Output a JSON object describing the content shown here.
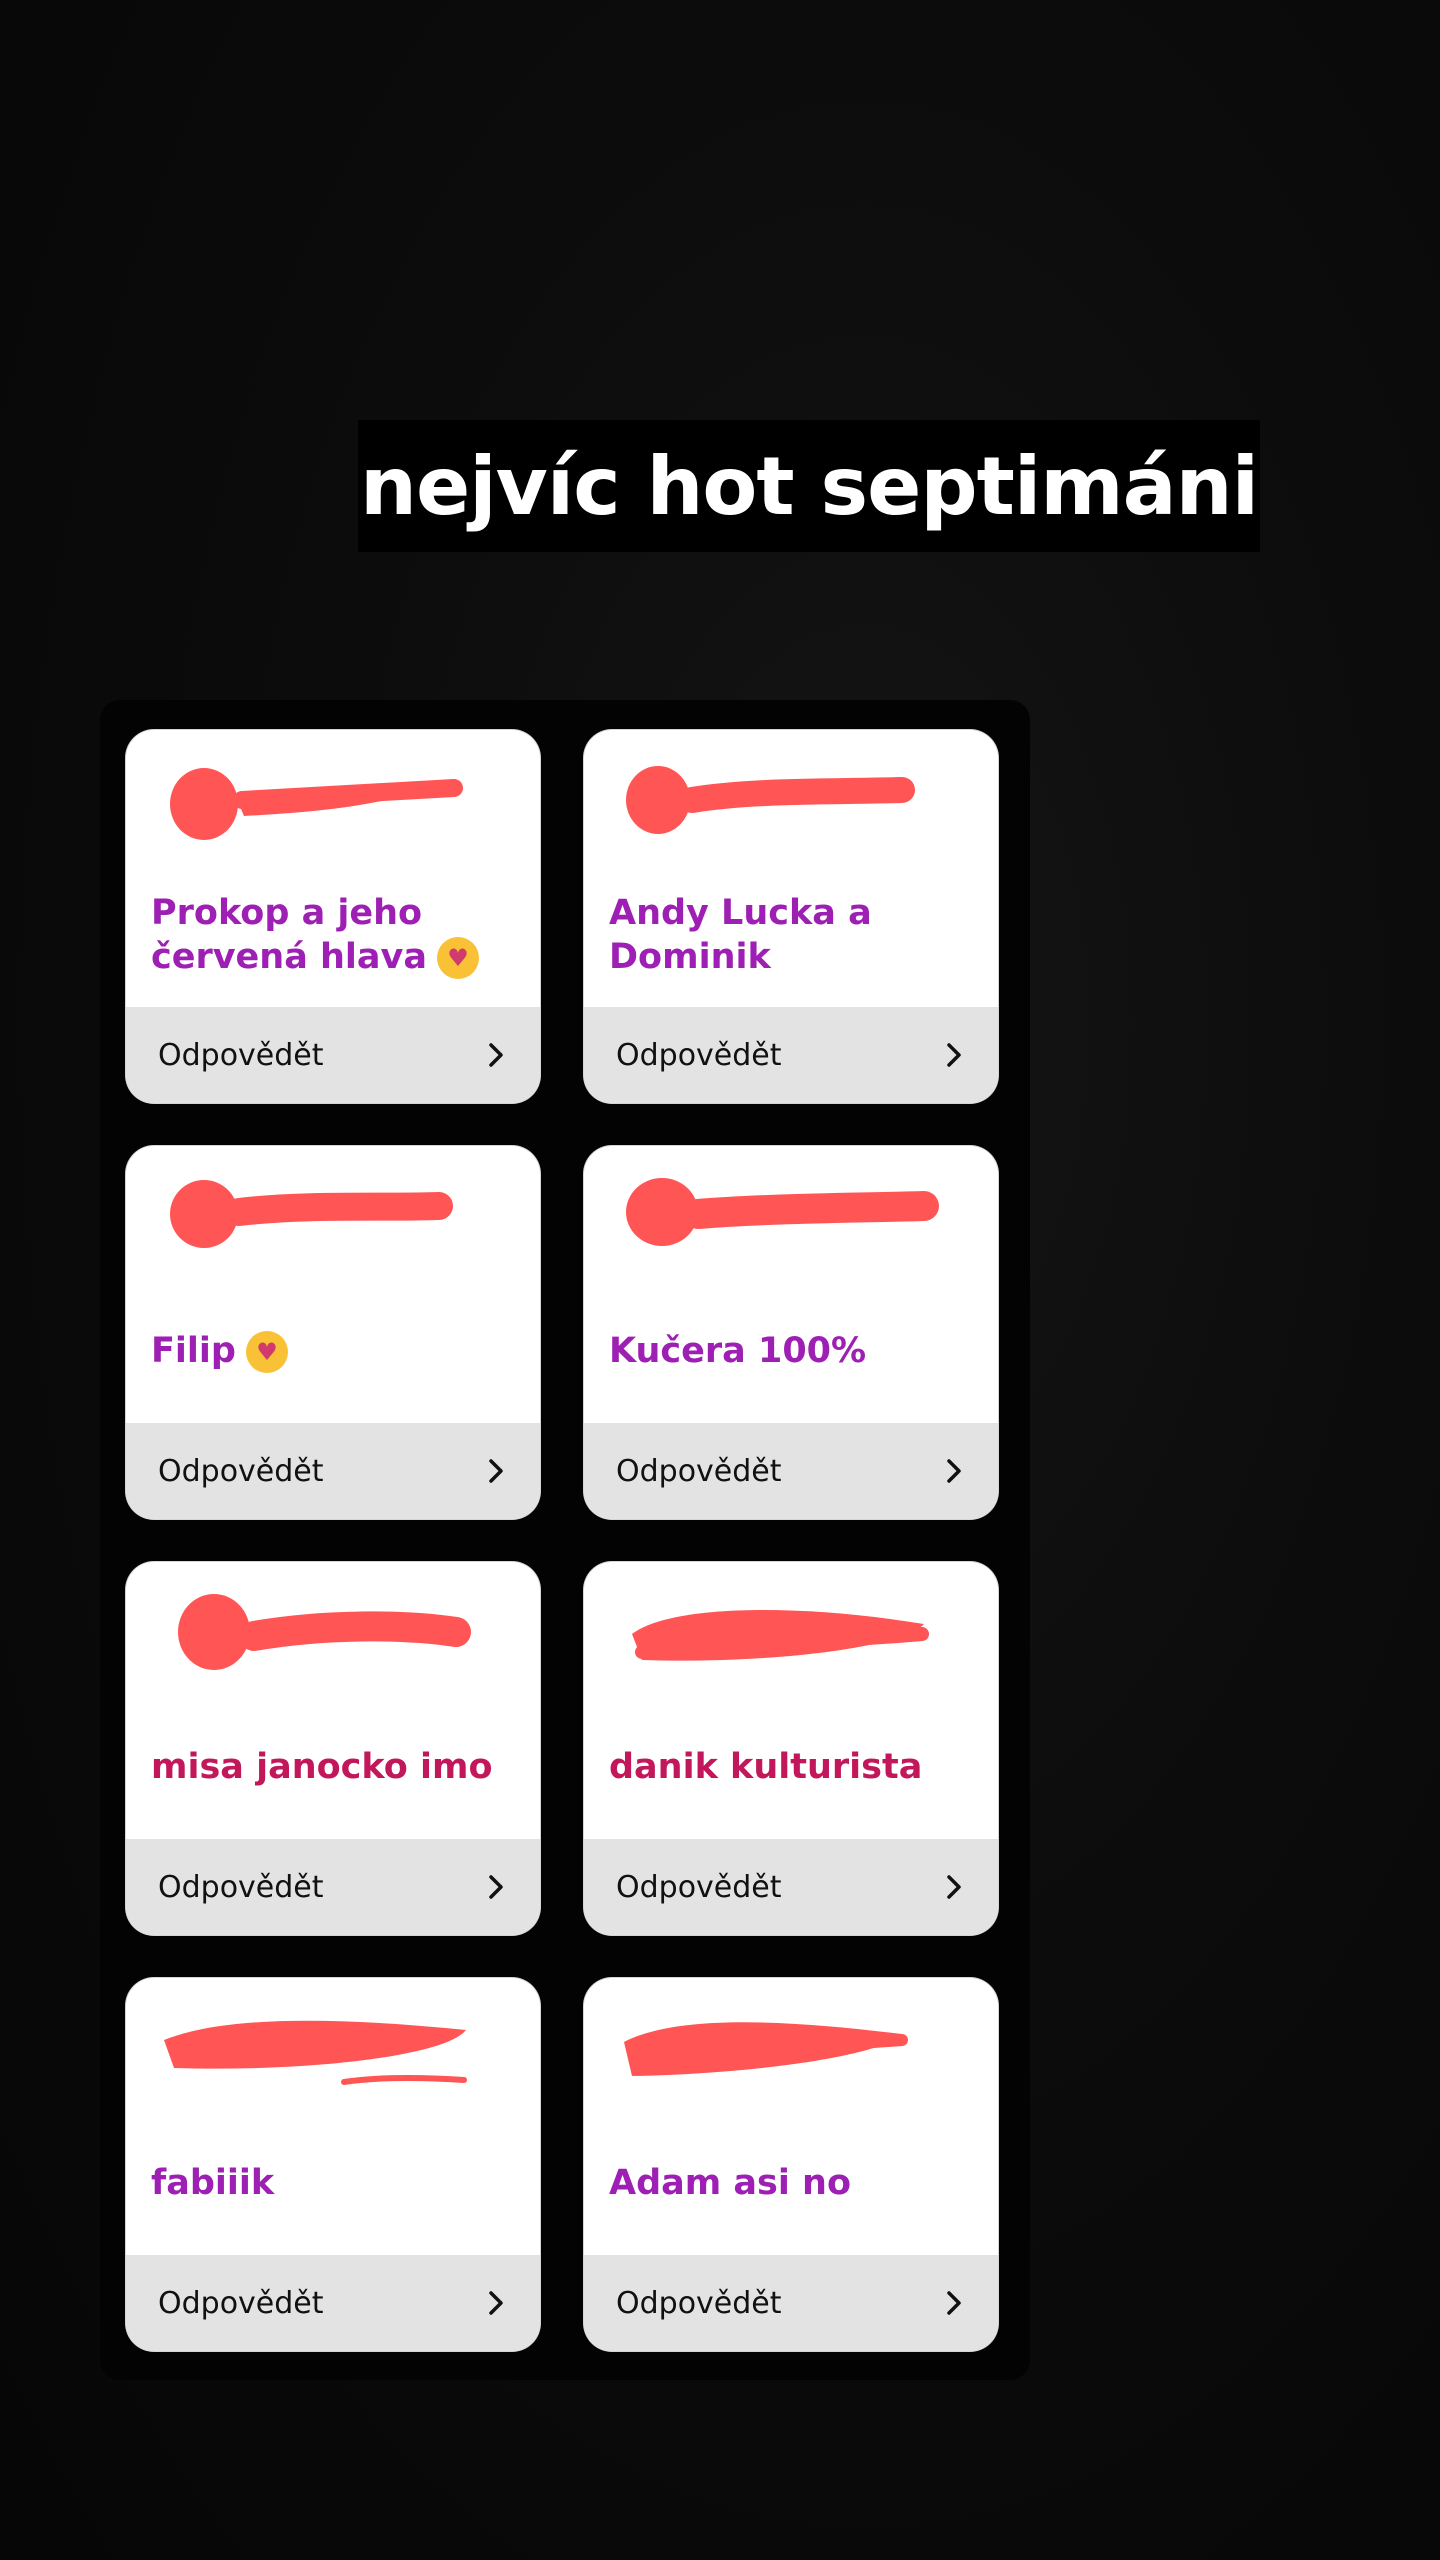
{
  "story": {
    "title": "nejvíc hot septimáni"
  },
  "cards": [
    {
      "text": "Prokop a jeho červená hlava",
      "emoji": "♥",
      "reply_label": "Odpovědět",
      "chevron_icon": "chevron-right-icon"
    },
    {
      "text": "Andy Lucka a Dominik",
      "reply_label": "Odpovědět",
      "chevron_icon": "chevron-right-icon"
    },
    {
      "text": "Filip",
      "emoji": "♥",
      "reply_label": "Odpovědět",
      "chevron_icon": "chevron-right-icon"
    },
    {
      "text": "Kučera 100%",
      "reply_label": "Odpovědět",
      "chevron_icon": "chevron-right-icon"
    },
    {
      "text": "misa janocko imo",
      "reply_label": "Odpovědět",
      "chevron_icon": "chevron-right-icon"
    },
    {
      "text": "danik kulturista",
      "reply_label": "Odpovědět",
      "chevron_icon": "chevron-right-icon"
    },
    {
      "text": "fabiiik",
      "reply_label": "Odpovědět",
      "chevron_icon": "chevron-right-icon"
    },
    {
      "text": "Adam asi no",
      "reply_label": "Odpovědět",
      "chevron_icon": "chevron-right-icon"
    }
  ],
  "colors": {
    "text_accent": "#9e1fb3",
    "text_accent_alt": "#c2185b",
    "redaction": "#ff5555",
    "reply_bar": "#e3e3e3"
  }
}
